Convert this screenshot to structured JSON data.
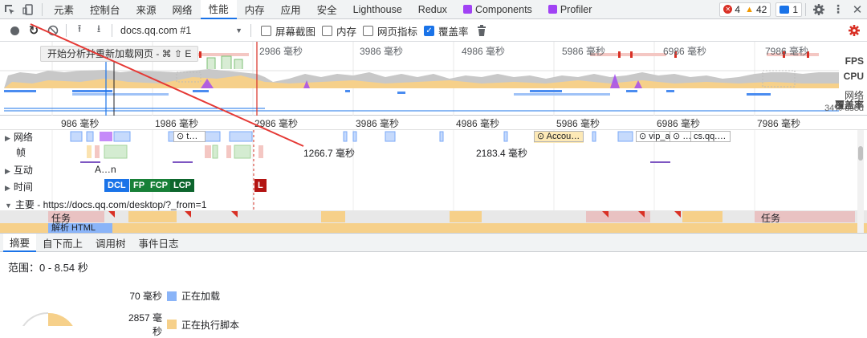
{
  "tabs": [
    {
      "label": "元素"
    },
    {
      "label": "控制台"
    },
    {
      "label": "来源"
    },
    {
      "label": "网络"
    },
    {
      "label": "性能"
    },
    {
      "label": "内存"
    },
    {
      "label": "应用"
    },
    {
      "label": "安全"
    },
    {
      "label": "Lighthouse"
    },
    {
      "label": "Redux"
    },
    {
      "label": "Components"
    },
    {
      "label": "Profiler"
    }
  ],
  "status": {
    "errors": "4",
    "warnings": "42",
    "messages": "1"
  },
  "toolbar": {
    "profile_select": "docs.qq.com #1",
    "checkboxes": [
      {
        "label": "屏幕截图",
        "checked": false
      },
      {
        "label": "内存",
        "checked": false
      },
      {
        "label": "网页指标",
        "checked": false
      },
      {
        "label": "覆盖率",
        "checked": true
      }
    ]
  },
  "tooltip": "开始分析并重新加载网页 - ⌘ ⇧ E",
  "overview": {
    "ticks": [
      "986 毫秒",
      "1986 毫秒",
      "2986 毫秒",
      "3986 毫秒",
      "4986 毫秒",
      "5986 毫秒",
      "6986 毫秒",
      "7986 毫秒"
    ],
    "labels": {
      "fps": "FPS",
      "cpu": "CPU",
      "net": "网络",
      "coverage": "覆盖率",
      "coverage_pct": "34% used"
    }
  },
  "ruler": {
    "ticks": [
      "986 毫秒",
      "1986 毫秒",
      "2986 毫秒",
      "3986 毫秒",
      "4986 毫秒",
      "5986 毫秒",
      "6986 毫秒",
      "7986 毫秒"
    ]
  },
  "tracks": {
    "network": {
      "label": "网络",
      "events": [
        "t…",
        "Accou…",
        "vip_a…",
        "…",
        "cs.qq.…"
      ]
    },
    "frames": {
      "label": "帧",
      "frame1": "1266.7 毫秒",
      "frame2": "2183.4 毫秒"
    },
    "interactions": {
      "label": "互动",
      "event": "A…n"
    },
    "timings": {
      "label": "时间",
      "markers": [
        "DCL",
        "FP",
        "FCP",
        "LCP",
        "L"
      ]
    },
    "main": {
      "label": "主要 - https://docs.qq.com/desktop/?_from=1",
      "task_left": "任务",
      "task_right": "任务",
      "parse": "解析 HTML"
    }
  },
  "bottom": {
    "tabs": [
      "摘要",
      "自下而上",
      "调用树",
      "事件日志"
    ],
    "range": "范围：0 - 8.54 秒",
    "legend": [
      {
        "value": "70 毫秒",
        "label": "正在加载",
        "color": "#8ab4f8"
      },
      {
        "value": "2857 毫秒",
        "label": "正在执行脚本",
        "color": "#f6d08a"
      }
    ]
  },
  "colors": {
    "accent": "#1a73e8",
    "record": "#d93025",
    "scripting": "#f6d08a",
    "loading": "#8ab4f8",
    "rendering": "#a142f4",
    "painting": "#81c995",
    "fps_red": "#f28b82"
  }
}
